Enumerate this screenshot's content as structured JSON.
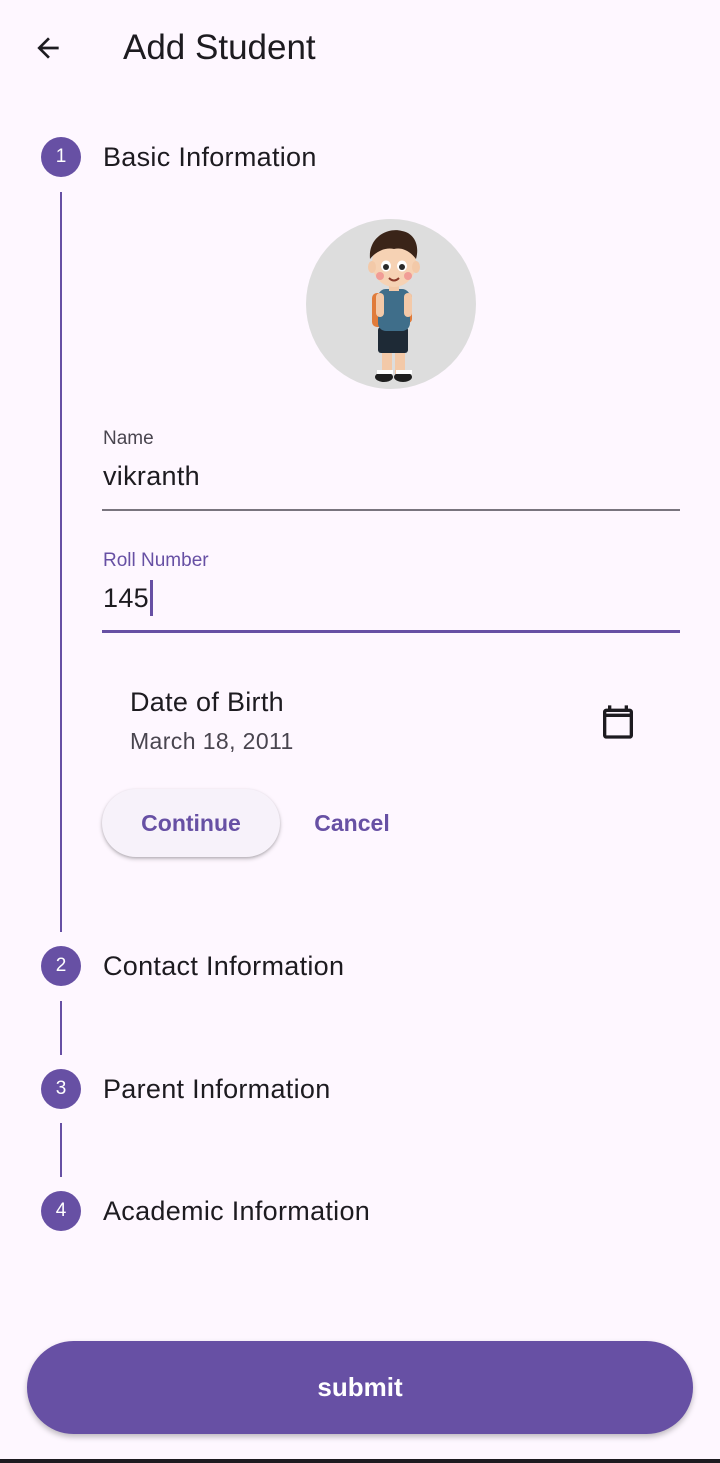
{
  "appbar": {
    "title": "Add Student"
  },
  "steps": [
    {
      "number": "1",
      "title": "Basic Information"
    },
    {
      "number": "2",
      "title": "Contact Information"
    },
    {
      "number": "3",
      "title": "Parent Information"
    },
    {
      "number": "4",
      "title": "Academic Information"
    }
  ],
  "form": {
    "name_label": "Name",
    "name_value": "vikranth",
    "roll_label": "Roll Number",
    "roll_value": "145",
    "dob_label": "Date of Birth",
    "dob_value": "March 18, 2011"
  },
  "buttons": {
    "continue": "Continue",
    "cancel": "Cancel",
    "submit": "submit"
  },
  "icons": {
    "back": "arrow-back-icon",
    "calendar": "calendar-icon"
  },
  "colors": {
    "primary": "#6750A4",
    "background": "#FEF7FF",
    "on_surface": "#1D1B20",
    "on_surface_variant": "#49454F"
  }
}
